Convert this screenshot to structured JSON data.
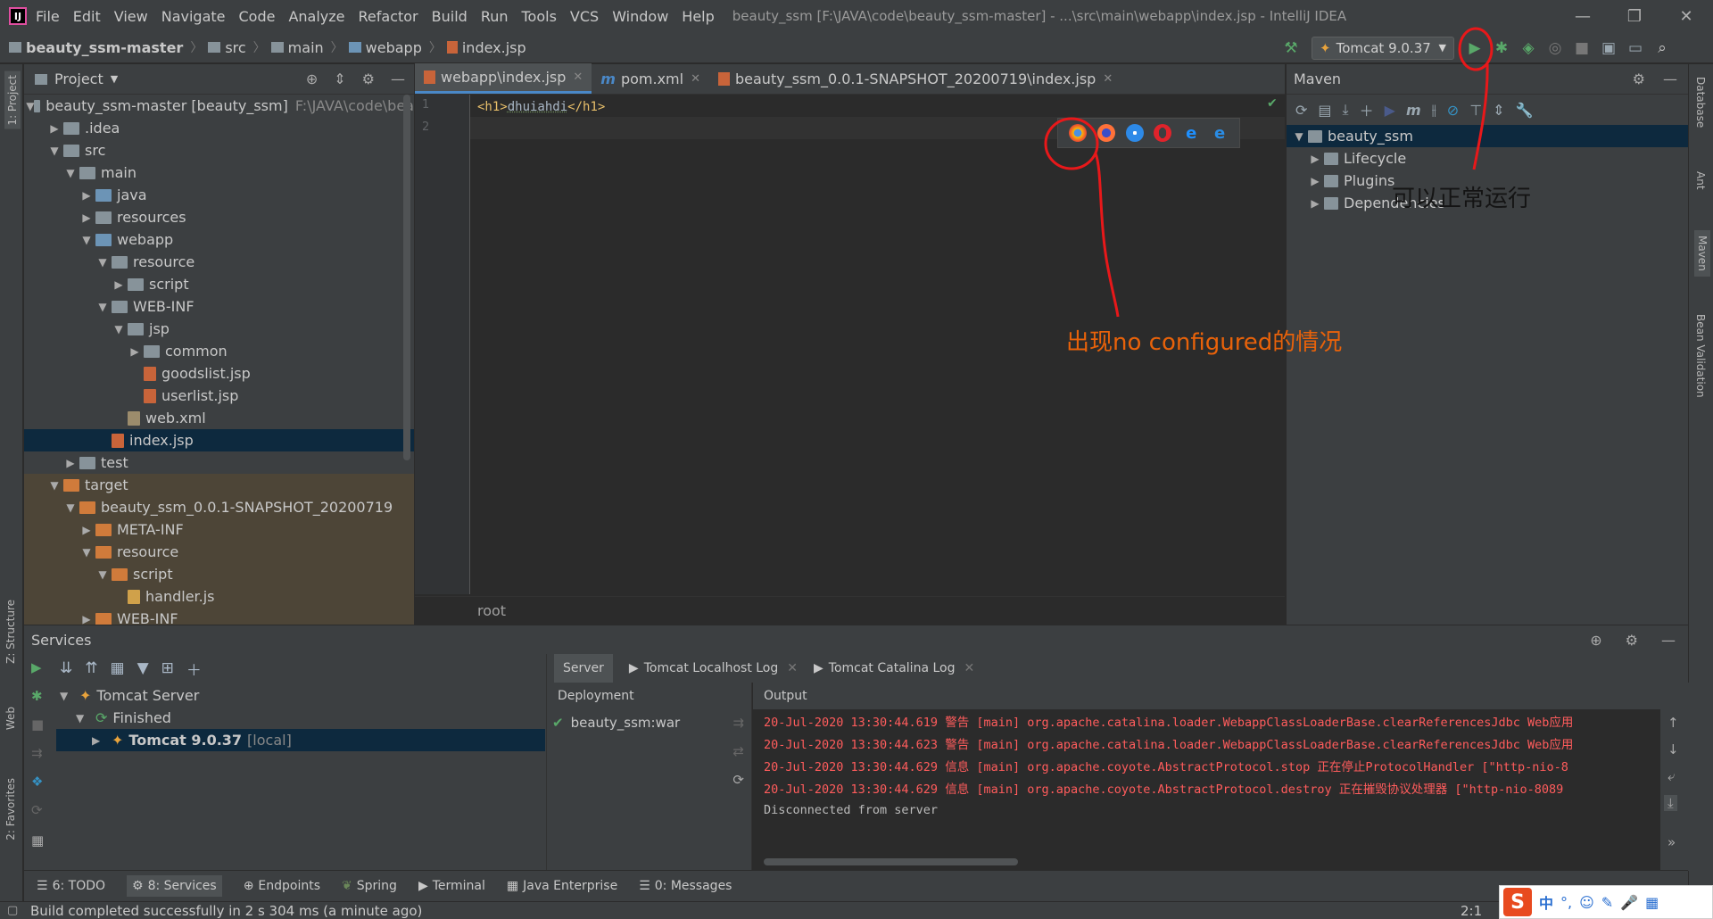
{
  "menubar": {
    "items": [
      "File",
      "Edit",
      "View",
      "Navigate",
      "Code",
      "Analyze",
      "Refactor",
      "Build",
      "Run",
      "Tools",
      "VCS",
      "Window",
      "Help"
    ],
    "title": "beauty_ssm [F:\\JAVA\\code\\beauty_ssm-master] - ...\\src\\main\\webapp\\index.jsp - IntelliJ IDEA"
  },
  "breadcrumbs": [
    "beauty_ssm-master",
    "src",
    "main",
    "webapp",
    "index.jsp"
  ],
  "run_config": "Tomcat 9.0.37",
  "project_panel": {
    "title": "Project",
    "tree": [
      {
        "label": "beauty_ssm-master [beauty_ssm]",
        "extra": "F:\\JAVA\\code\\bea",
        "depth": 0,
        "arrow": "▼",
        "icon": "grey"
      },
      {
        "label": ".idea",
        "depth": 1,
        "arrow": "▶",
        "icon": "grey"
      },
      {
        "label": "src",
        "depth": 1,
        "arrow": "▼",
        "icon": "grey"
      },
      {
        "label": "main",
        "depth": 2,
        "arrow": "▼",
        "icon": "grey"
      },
      {
        "label": "java",
        "depth": 3,
        "arrow": "▶",
        "icon": "blue"
      },
      {
        "label": "resources",
        "depth": 3,
        "arrow": "▶",
        "icon": "grey"
      },
      {
        "label": "webapp",
        "depth": 3,
        "arrow": "▼",
        "icon": "blue"
      },
      {
        "label": "resource",
        "depth": 4,
        "arrow": "▼",
        "icon": "grey"
      },
      {
        "label": "script",
        "depth": 5,
        "arrow": "▶",
        "icon": "grey"
      },
      {
        "label": "WEB-INF",
        "depth": 4,
        "arrow": "▼",
        "icon": "grey"
      },
      {
        "label": "jsp",
        "depth": 5,
        "arrow": "▼",
        "icon": "grey"
      },
      {
        "label": "common",
        "depth": 6,
        "arrow": "▶",
        "icon": "grey"
      },
      {
        "label": "goodslist.jsp",
        "depth": 6,
        "arrow": "",
        "icon": "jsp"
      },
      {
        "label": "userlist.jsp",
        "depth": 6,
        "arrow": "",
        "icon": "jsp"
      },
      {
        "label": "web.xml",
        "depth": 5,
        "arrow": "",
        "icon": "xml"
      },
      {
        "label": "index.jsp",
        "depth": 4,
        "arrow": "",
        "icon": "jsp",
        "selected": true
      },
      {
        "label": "test",
        "depth": 2,
        "arrow": "▶",
        "icon": "grey"
      },
      {
        "label": "target",
        "depth": 1,
        "arrow": "▼",
        "icon": "orange",
        "target": true
      },
      {
        "label": "beauty_ssm_0.0.1-SNAPSHOT_20200719",
        "depth": 2,
        "arrow": "▼",
        "icon": "orange",
        "target": true
      },
      {
        "label": "META-INF",
        "depth": 3,
        "arrow": "▶",
        "icon": "orange",
        "target": true
      },
      {
        "label": "resource",
        "depth": 3,
        "arrow": "▼",
        "icon": "orange",
        "target": true
      },
      {
        "label": "script",
        "depth": 4,
        "arrow": "▼",
        "icon": "orange",
        "target": true
      },
      {
        "label": "handler.js",
        "depth": 5,
        "arrow": "",
        "icon": "js",
        "target": true
      },
      {
        "label": "WEB-INF",
        "depth": 3,
        "arrow": "▶",
        "icon": "orange",
        "target": true
      }
    ]
  },
  "editor": {
    "tabs": [
      {
        "label": "webapp\\index.jsp",
        "active": true
      },
      {
        "label": "pom.xml",
        "active": false
      },
      {
        "label": "beauty_ssm_0.0.1-SNAPSHOT_20200719\\index.jsp",
        "active": false
      }
    ],
    "lines": [
      "1",
      "2"
    ],
    "code_open": "<h1>",
    "code_text": "dhuiahdi",
    "code_close": "</h1>",
    "breadcrumb": "root"
  },
  "maven_panel": {
    "title": "Maven",
    "tree": [
      {
        "label": "beauty_ssm",
        "arrow": "▼",
        "selected": true
      },
      {
        "label": "Lifecycle",
        "arrow": "▶"
      },
      {
        "label": "Plugins",
        "arrow": "▶"
      },
      {
        "label": "Dependencies",
        "arrow": "▶"
      }
    ]
  },
  "annotations": {
    "not_configured": "出现no configured的情况",
    "runs_normally": "可以正常运行"
  },
  "services": {
    "title": "Services",
    "tree": [
      {
        "label": "Tomcat Server",
        "arrow": "▼"
      },
      {
        "label": "Finished",
        "arrow": "▼"
      },
      {
        "label": "Tomcat 9.0.37",
        "suffix": "[local]",
        "arrow": "▶",
        "selected": true
      }
    ],
    "tabs": [
      "Server",
      "Tomcat Localhost Log",
      "Tomcat Catalina Log"
    ],
    "deployment_header": "Deployment",
    "deployment_item": "beauty_ssm:war",
    "output_header": "Output",
    "log": [
      {
        "text": "20-Jul-2020 13:30:44.619 警告 [main] org.apache.catalina.loader.WebappClassLoaderBase.clearReferencesJdbc Web应用",
        "color": "#ff5c5c"
      },
      {
        "text": "20-Jul-2020 13:30:44.623 警告 [main] org.apache.catalina.loader.WebappClassLoaderBase.clearReferencesJdbc Web应用",
        "color": "#ff5c5c"
      },
      {
        "text": "20-Jul-2020 13:30:44.629 信息 [main] org.apache.coyote.AbstractProtocol.stop 正在停止ProtocolHandler [\"http-nio-8",
        "color": "#ff5c5c"
      },
      {
        "text": "20-Jul-2020 13:30:44.629 信息 [main] org.apache.coyote.AbstractProtocol.destroy 正在摧毁协议处理器 [\"http-nio-8089",
        "color": "#ff5c5c"
      },
      {
        "text": "Disconnected from server",
        "color": "#bbbbbb"
      }
    ]
  },
  "bottom_tabs": [
    "6: TODO",
    "8: Services",
    "Endpoints",
    "Spring",
    "Terminal",
    "Java Enterprise",
    "0: Messages"
  ],
  "status": {
    "message": "Build completed successfully in 2 s 304 ms (a minute ago)",
    "position": "2:1"
  },
  "left_strip": [
    "1: Project",
    "Z: Structure",
    "Web",
    "2: Favorites"
  ],
  "right_strip": [
    "Database",
    "Ant",
    "Maven",
    "Bean Validation"
  ],
  "ime": {
    "lang": "中"
  }
}
